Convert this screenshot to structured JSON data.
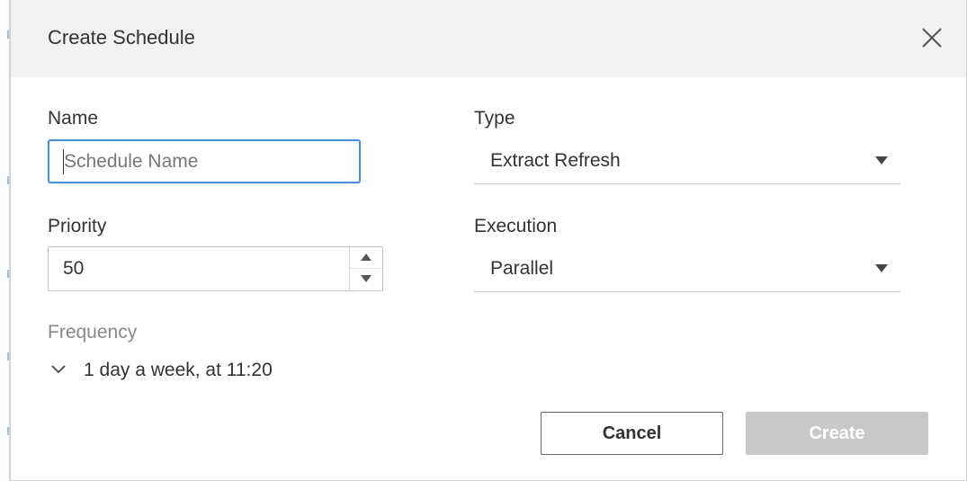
{
  "dialog": {
    "title": "Create Schedule"
  },
  "form": {
    "name": {
      "label": "Name",
      "value": "",
      "placeholder": "Schedule Name"
    },
    "type": {
      "label": "Type",
      "selected": "Extract Refresh"
    },
    "priority": {
      "label": "Priority",
      "value": "50"
    },
    "execution": {
      "label": "Execution",
      "selected": "Parallel"
    },
    "frequency": {
      "label": "Frequency",
      "summary": "1 day a week, at 11:20"
    }
  },
  "actions": {
    "cancel_label": "Cancel",
    "create_label": "Create",
    "create_enabled": false
  },
  "icons": {
    "close": "close-icon",
    "dropdown": "caret-down-icon",
    "stepper_up": "caret-up-icon",
    "stepper_down": "caret-down-icon",
    "frequency_toggle": "chevron-down-icon"
  },
  "colors": {
    "header_bg": "#f2f2f2",
    "focus_border": "#4a90d9",
    "disabled_button": "#c8c8c8",
    "muted_label": "#888888"
  }
}
